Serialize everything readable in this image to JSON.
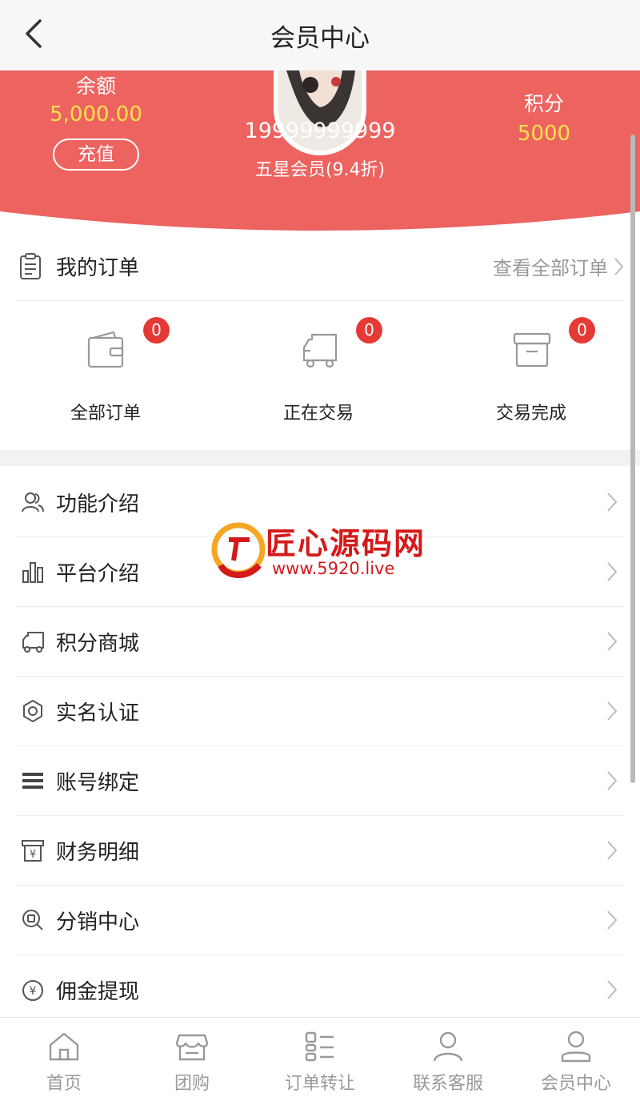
{
  "nav": {
    "title": "会员中心",
    "back_icon": "chevron-left-icon"
  },
  "header": {
    "bg_color": "#ec6360",
    "balance_label": "余额",
    "balance_value": "5,000.00",
    "recharge_label": "充值",
    "phone": "19999999999",
    "level": "五星会员(9.4折)",
    "points_label": "积分",
    "points_value": "5000",
    "value_color": "#ffe14d"
  },
  "orders": {
    "title": "我的订单",
    "view_all": "查看全部订单",
    "items": [
      {
        "label": "全部订单",
        "count": "0",
        "icon": "wallet-icon"
      },
      {
        "label": "正在交易",
        "count": "0",
        "icon": "truck-icon"
      },
      {
        "label": "交易完成",
        "count": "0",
        "icon": "archive-box-icon"
      }
    ]
  },
  "menu": [
    {
      "label": "功能介绍",
      "icon": "users-icon"
    },
    {
      "label": "平台介绍",
      "icon": "bar-chart-icon"
    },
    {
      "label": "积分商城",
      "icon": "truck-icon"
    },
    {
      "label": "实名认证",
      "icon": "gear-icon"
    },
    {
      "label": "账号绑定",
      "icon": "list-icon"
    },
    {
      "label": "财务明细",
      "icon": "yen-receipt-icon"
    },
    {
      "label": "分销中心",
      "icon": "search-coupon-icon"
    },
    {
      "label": "佣金提现",
      "icon": "yen-circle-icon"
    }
  ],
  "watermark": {
    "text": "匠心源码网",
    "url": "www.5920.live"
  },
  "tabs": [
    {
      "label": "首页",
      "icon": "home-icon"
    },
    {
      "label": "团购",
      "icon": "store-icon"
    },
    {
      "label": "订单转让",
      "icon": "order-list-icon"
    },
    {
      "label": "联系客服",
      "icon": "user-icon"
    },
    {
      "label": "会员中心",
      "icon": "member-icon"
    }
  ],
  "colors": {
    "accent": "#ec6360",
    "badge": "#e53935",
    "muted": "#999999"
  }
}
